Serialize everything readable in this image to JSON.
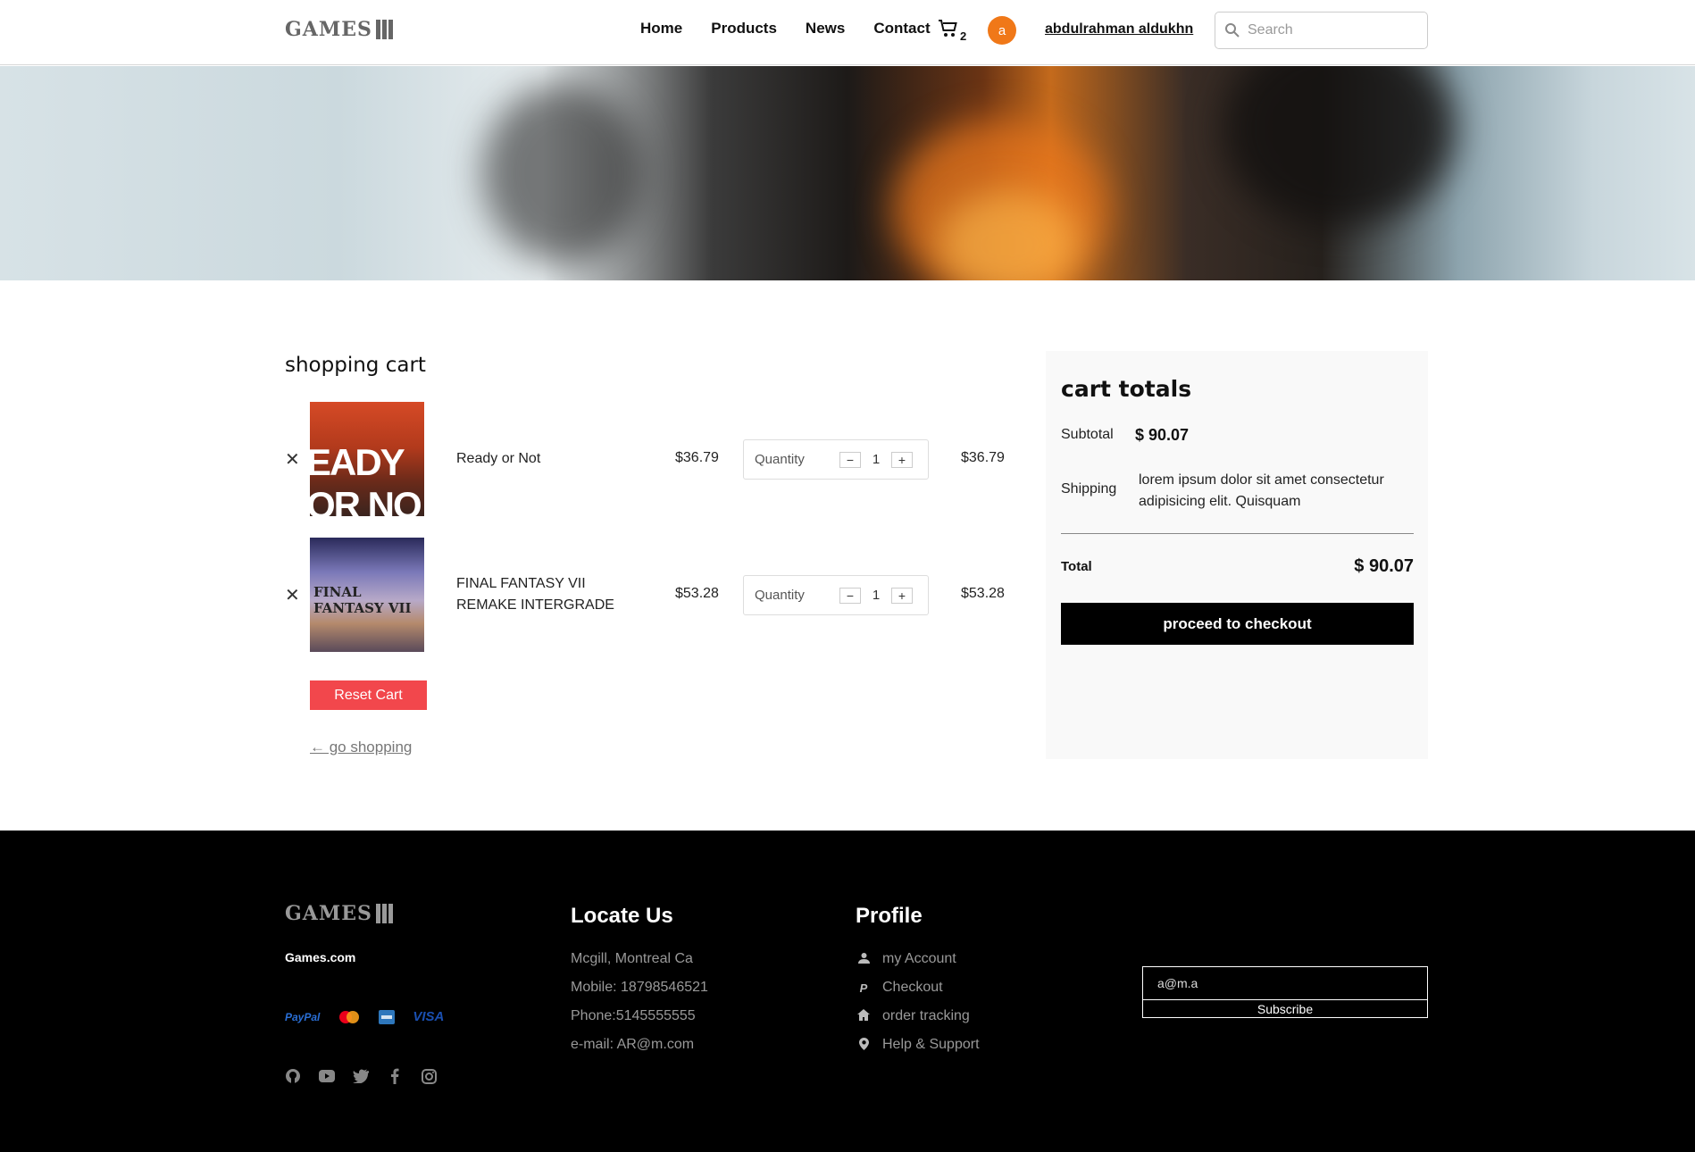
{
  "header": {
    "logo_text": "GAMES",
    "nav": [
      {
        "label": "Home"
      },
      {
        "label": "Products"
      },
      {
        "label": "News"
      },
      {
        "label": "Contact"
      }
    ],
    "cart_count": "2",
    "avatar_letter": "a",
    "username": "abdulrahman aldukhn",
    "search_placeholder": "Search",
    "icons": {
      "cart": "cart-icon",
      "search": "search-icon"
    },
    "accent_color": "#f07818"
  },
  "cart": {
    "title": "shopping cart",
    "quantity_label": "Quantity",
    "items": [
      {
        "name": "Ready or Not",
        "price": "$36.79",
        "quantity": "1",
        "total": "$36.79",
        "thumb_text": "EADY OR NO"
      },
      {
        "name": "FINAL FANTASY VII REMAKE INTERGRADE",
        "price": "$53.28",
        "quantity": "1",
        "total": "$53.28",
        "thumb_text": "FINAL FANTASY VII"
      }
    ],
    "reset_label": "Reset Cart",
    "go_shopping_label": "← go shopping",
    "reset_color": "#f2474c"
  },
  "totals": {
    "title": "cart totals",
    "subtotal_label": "Subtotal",
    "subtotal_value": "$ 90.07",
    "shipping_label": "Shipping",
    "shipping_text": "lorem ipsum dolor sit amet consectetur adipisicing elit. Quisquam",
    "total_label": "Total",
    "total_value": "$ 90.07",
    "checkout_label": "proceed to checkout"
  },
  "footer": {
    "logo_text": "GAMES",
    "site": "Games.com",
    "payments": [
      "PayPal",
      "Mastercard",
      "Amex",
      "VISA"
    ],
    "social_icons": [
      "github-icon",
      "youtube-icon",
      "twitter-icon",
      "facebook-icon",
      "instagram-icon"
    ],
    "locate": {
      "title": "Locate Us",
      "lines": [
        "Mcgill, Montreal Ca",
        "Mobile: 18798546521",
        "Phone:5145555555",
        "e-mail: AR@m.com"
      ]
    },
    "profile": {
      "title": "Profile",
      "links": [
        {
          "label": "my Account",
          "icon": "user-icon"
        },
        {
          "label": "Checkout",
          "icon": "paypal-icon"
        },
        {
          "label": "order tracking",
          "icon": "home-icon"
        },
        {
          "label": "Help & Support",
          "icon": "location-pin-icon"
        }
      ]
    },
    "subscribe": {
      "email_value": "a@m.a",
      "button_label": "Subscribe"
    }
  }
}
